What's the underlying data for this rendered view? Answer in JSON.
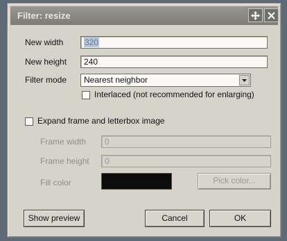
{
  "window": {
    "title": "Filter: resize"
  },
  "fields": {
    "new_width_label": "New width",
    "new_width_value": "320",
    "new_height_label": "New height",
    "new_height_value": "240",
    "filter_mode_label": "Filter mode",
    "filter_mode_value": "Nearest neighbor",
    "interlaced_label": "Interlaced (not recommended for enlarging)",
    "interlaced_checked": false,
    "expand_label": "Expand frame and letterbox image",
    "expand_checked": false,
    "frame_width_label": "Frame width",
    "frame_width_value": "0",
    "frame_height_label": "Frame height",
    "frame_height_value": "0",
    "fill_color_label": "Fill color",
    "fill_color": "#0c0c0c",
    "pick_color_label": "Pick color..."
  },
  "buttons": {
    "show_preview": "Show preview",
    "cancel": "Cancel",
    "ok": "OK"
  },
  "icons": {
    "move": "move-icon",
    "close": "close-icon"
  }
}
